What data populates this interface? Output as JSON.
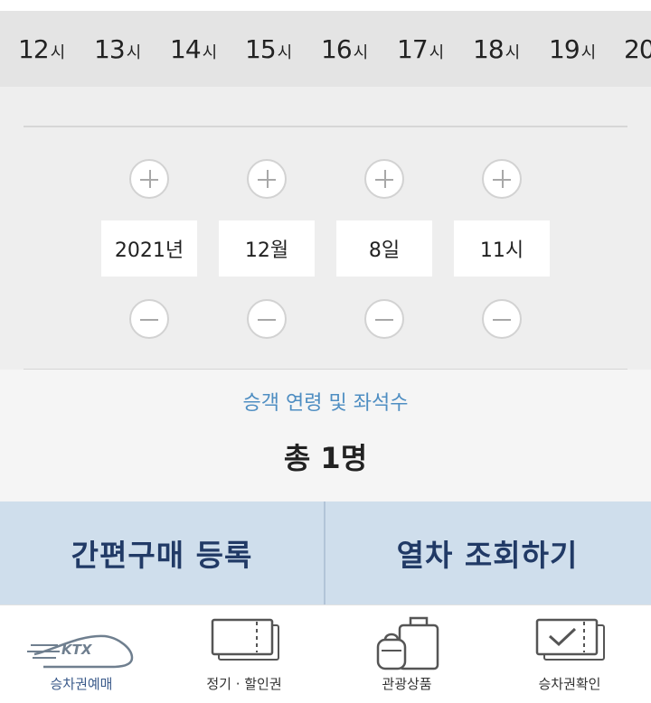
{
  "hour_scroller": {
    "unit": "시",
    "hours": [
      "12",
      "13",
      "14",
      "15",
      "16",
      "17",
      "18",
      "19",
      "20"
    ]
  },
  "datetime_picker": {
    "year": "2021년",
    "month": "12월",
    "day": "8일",
    "hour": "11시"
  },
  "passengers": {
    "label": "승객 연령 및 좌석수",
    "total": "총 1명"
  },
  "actions": {
    "quick_purchase_register": "간편구매 등록",
    "train_search": "열차 조회하기"
  },
  "tabbar": {
    "ticket_reservation": "승차권예매",
    "commuter_discount": "정기 · 할인권",
    "tour_products": "관광상품",
    "ticket_check": "승차권확인",
    "ktx_logo_text": "KTX"
  },
  "colors": {
    "accent_text": "#4f8ec2",
    "action_bg": "#cfdeec",
    "action_text": "#213a66"
  }
}
